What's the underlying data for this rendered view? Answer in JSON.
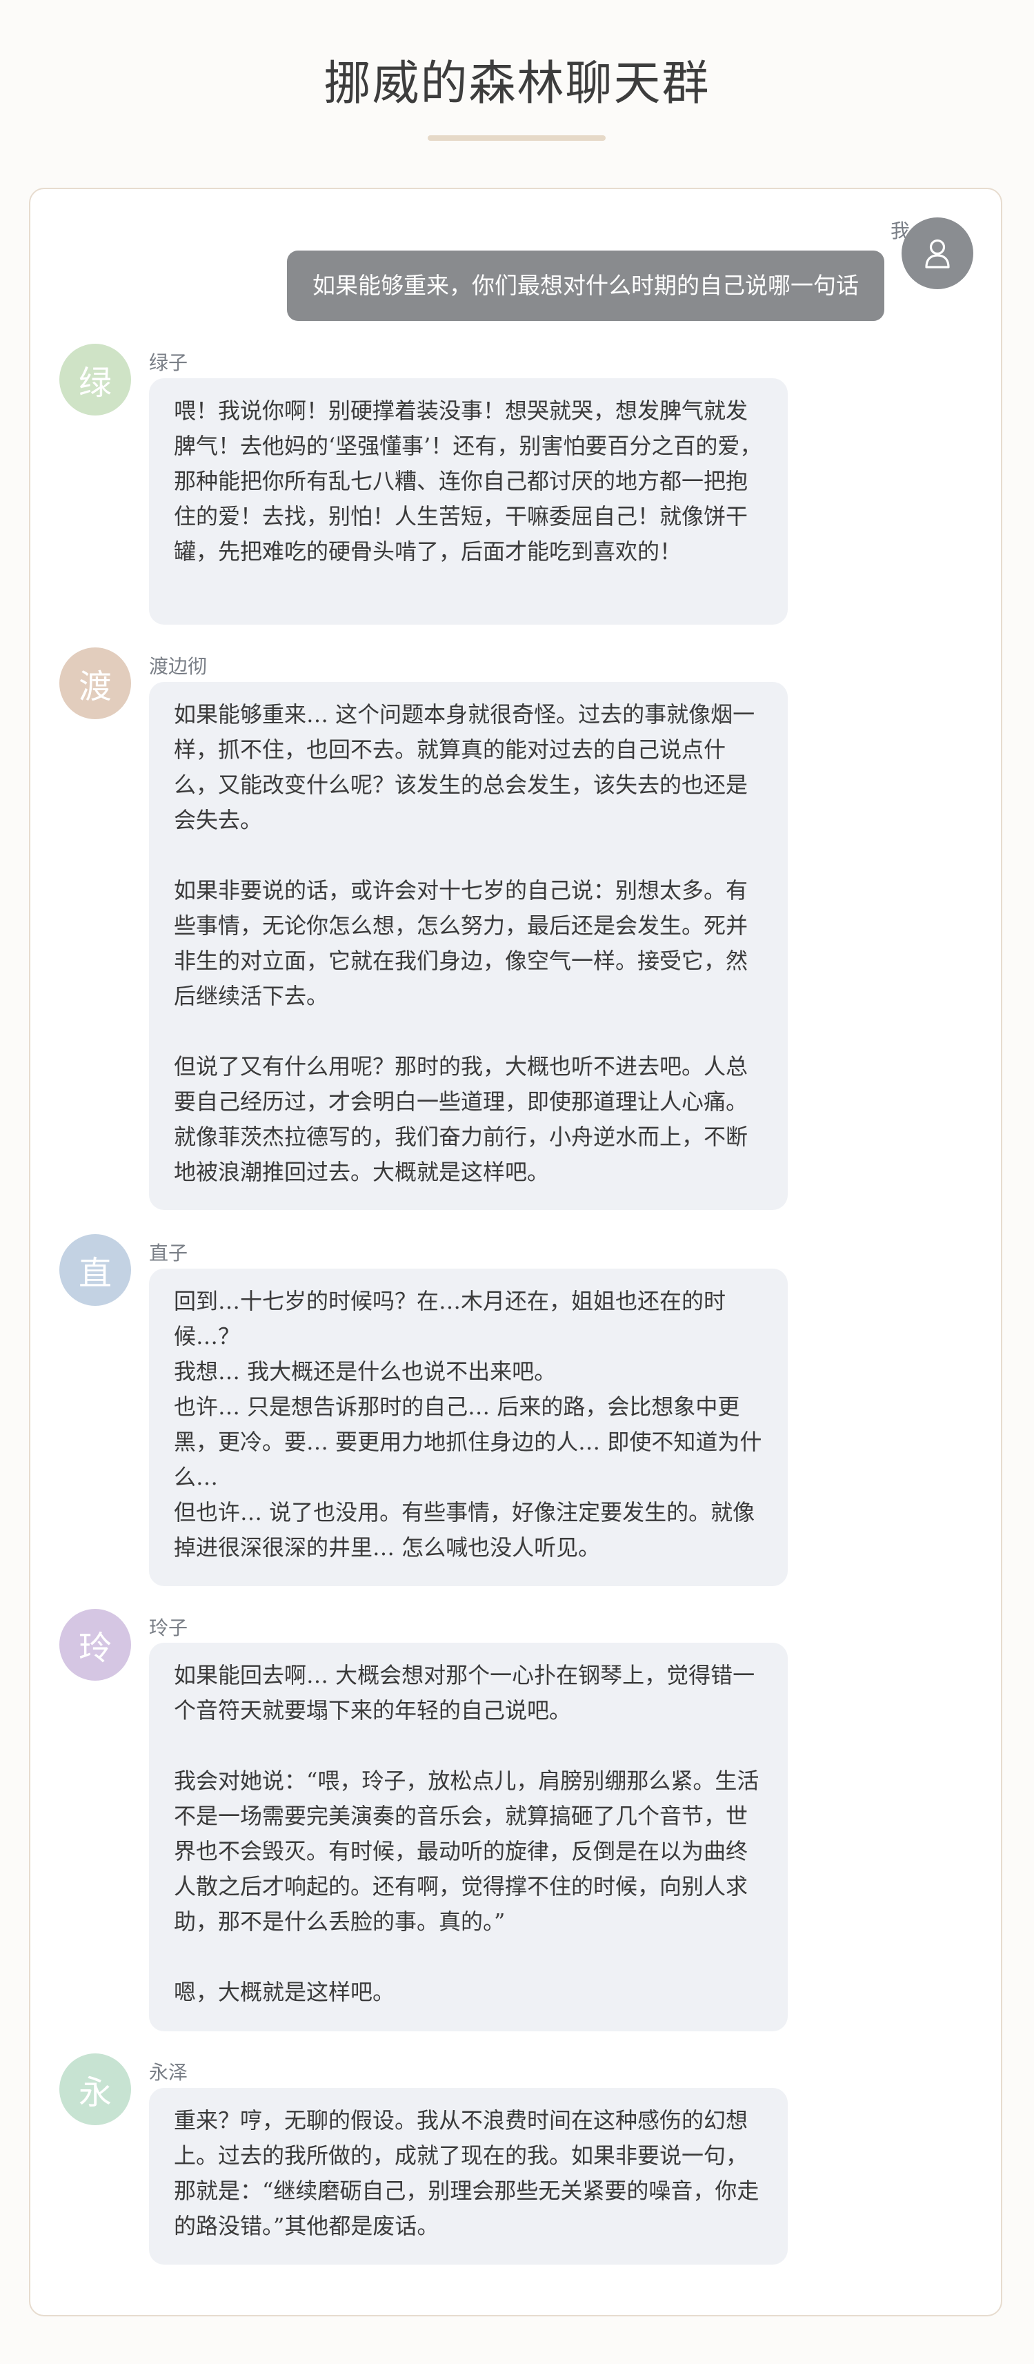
{
  "header": {
    "title": "挪威的森林聊天群"
  },
  "question": {
    "sender": "我",
    "text": "如果能够重来，你们最想对什么时期的自己说哪一句话"
  },
  "messages": [
    {
      "name": "绿子",
      "avatar": "绿",
      "avatar_color": "#cfe3c6",
      "text": "喂！我说你啊！别硬撑着装没事！想哭就哭，想发脾气就发脾气！去他妈的‘坚强懂事’！还有，别害怕要百分之百的爱，那种能把你所有乱七八糟、连你自己都讨厌的地方都一把抱住的爱！去找，别怕！人生苦短，干嘛委屈自己！就像饼干罐，先把难吃的硬骨头啃了，后面才能吃到喜欢的！"
    },
    {
      "name": "渡边彻",
      "avatar": "渡",
      "avatar_color": "#e2cdbd",
      "text": "如果能够重来… 这个问题本身就很奇怪。过去的事就像烟一样，抓不住，也回不去。就算真的能对过去的自己说点什么，又能改变什么呢？该发生的总会发生，该失去的也还是会失去。\n\n如果非要说的话，或许会对十七岁的自己说：别想太多。有些事情，无论你怎么想，怎么努力，最后还是会发生。死并非生的对立面，它就在我们身边，像空气一样。接受它，然后继续活下去。\n\n但说了又有什么用呢？那时的我，大概也听不进去吧。人总要自己经历过，才会明白一些道理，即使那道理让人心痛。就像菲茨杰拉德写的，我们奋力前行，小舟逆水而上，不断地被浪潮推回过去。大概就是这样吧。"
    },
    {
      "name": "直子",
      "avatar": "直",
      "avatar_color": "#c3d2e3",
      "text": "回到…十七岁的时候吗？在…木月还在，姐姐也还在的时候…？\n我想… 我大概还是什么也说不出来吧。\n也许… 只是想告诉那时的自己… 后来的路，会比想象中更黑，更冷。要… 要更用力地抓住身边的人… 即使不知道为什么…\n但也许… 说了也没用。有些事情，好像注定要发生的。就像掉进很深很深的井里… 怎么喊也没人听见。"
    },
    {
      "name": "玲子",
      "avatar": "玲",
      "avatar_color": "#d5c6e3",
      "text": "如果能回去啊… 大概会想对那个一心扑在钢琴上，觉得错一个音符天就要塌下来的年轻的自己说吧。\n\n我会对她说：“喂，玲子，放松点儿，肩膀别绷那么紧。生活不是一场需要完美演奏的音乐会，就算搞砸了几个音节，世界也不会毁灭。有时候，最动听的旋律，反倒是在以为曲终人散之后才响起的。还有啊，觉得撑不住的时候，向别人求助，那不是什么丢脸的事。真的。”\n\n嗯，大概就是这样吧。"
    },
    {
      "name": "永泽",
      "avatar": "永",
      "avatar_color": "#c7e3d2",
      "text": "重来？哼，无聊的假设。我从不浪费时间在这种感伤的幻想上。过去的我所做的，成就了现在的我。如果非要说一句，那就是：“继续磨砺自己，别理会那些无关紧要的噪音，你走的路没错。”其他都是废话。"
    }
  ]
}
